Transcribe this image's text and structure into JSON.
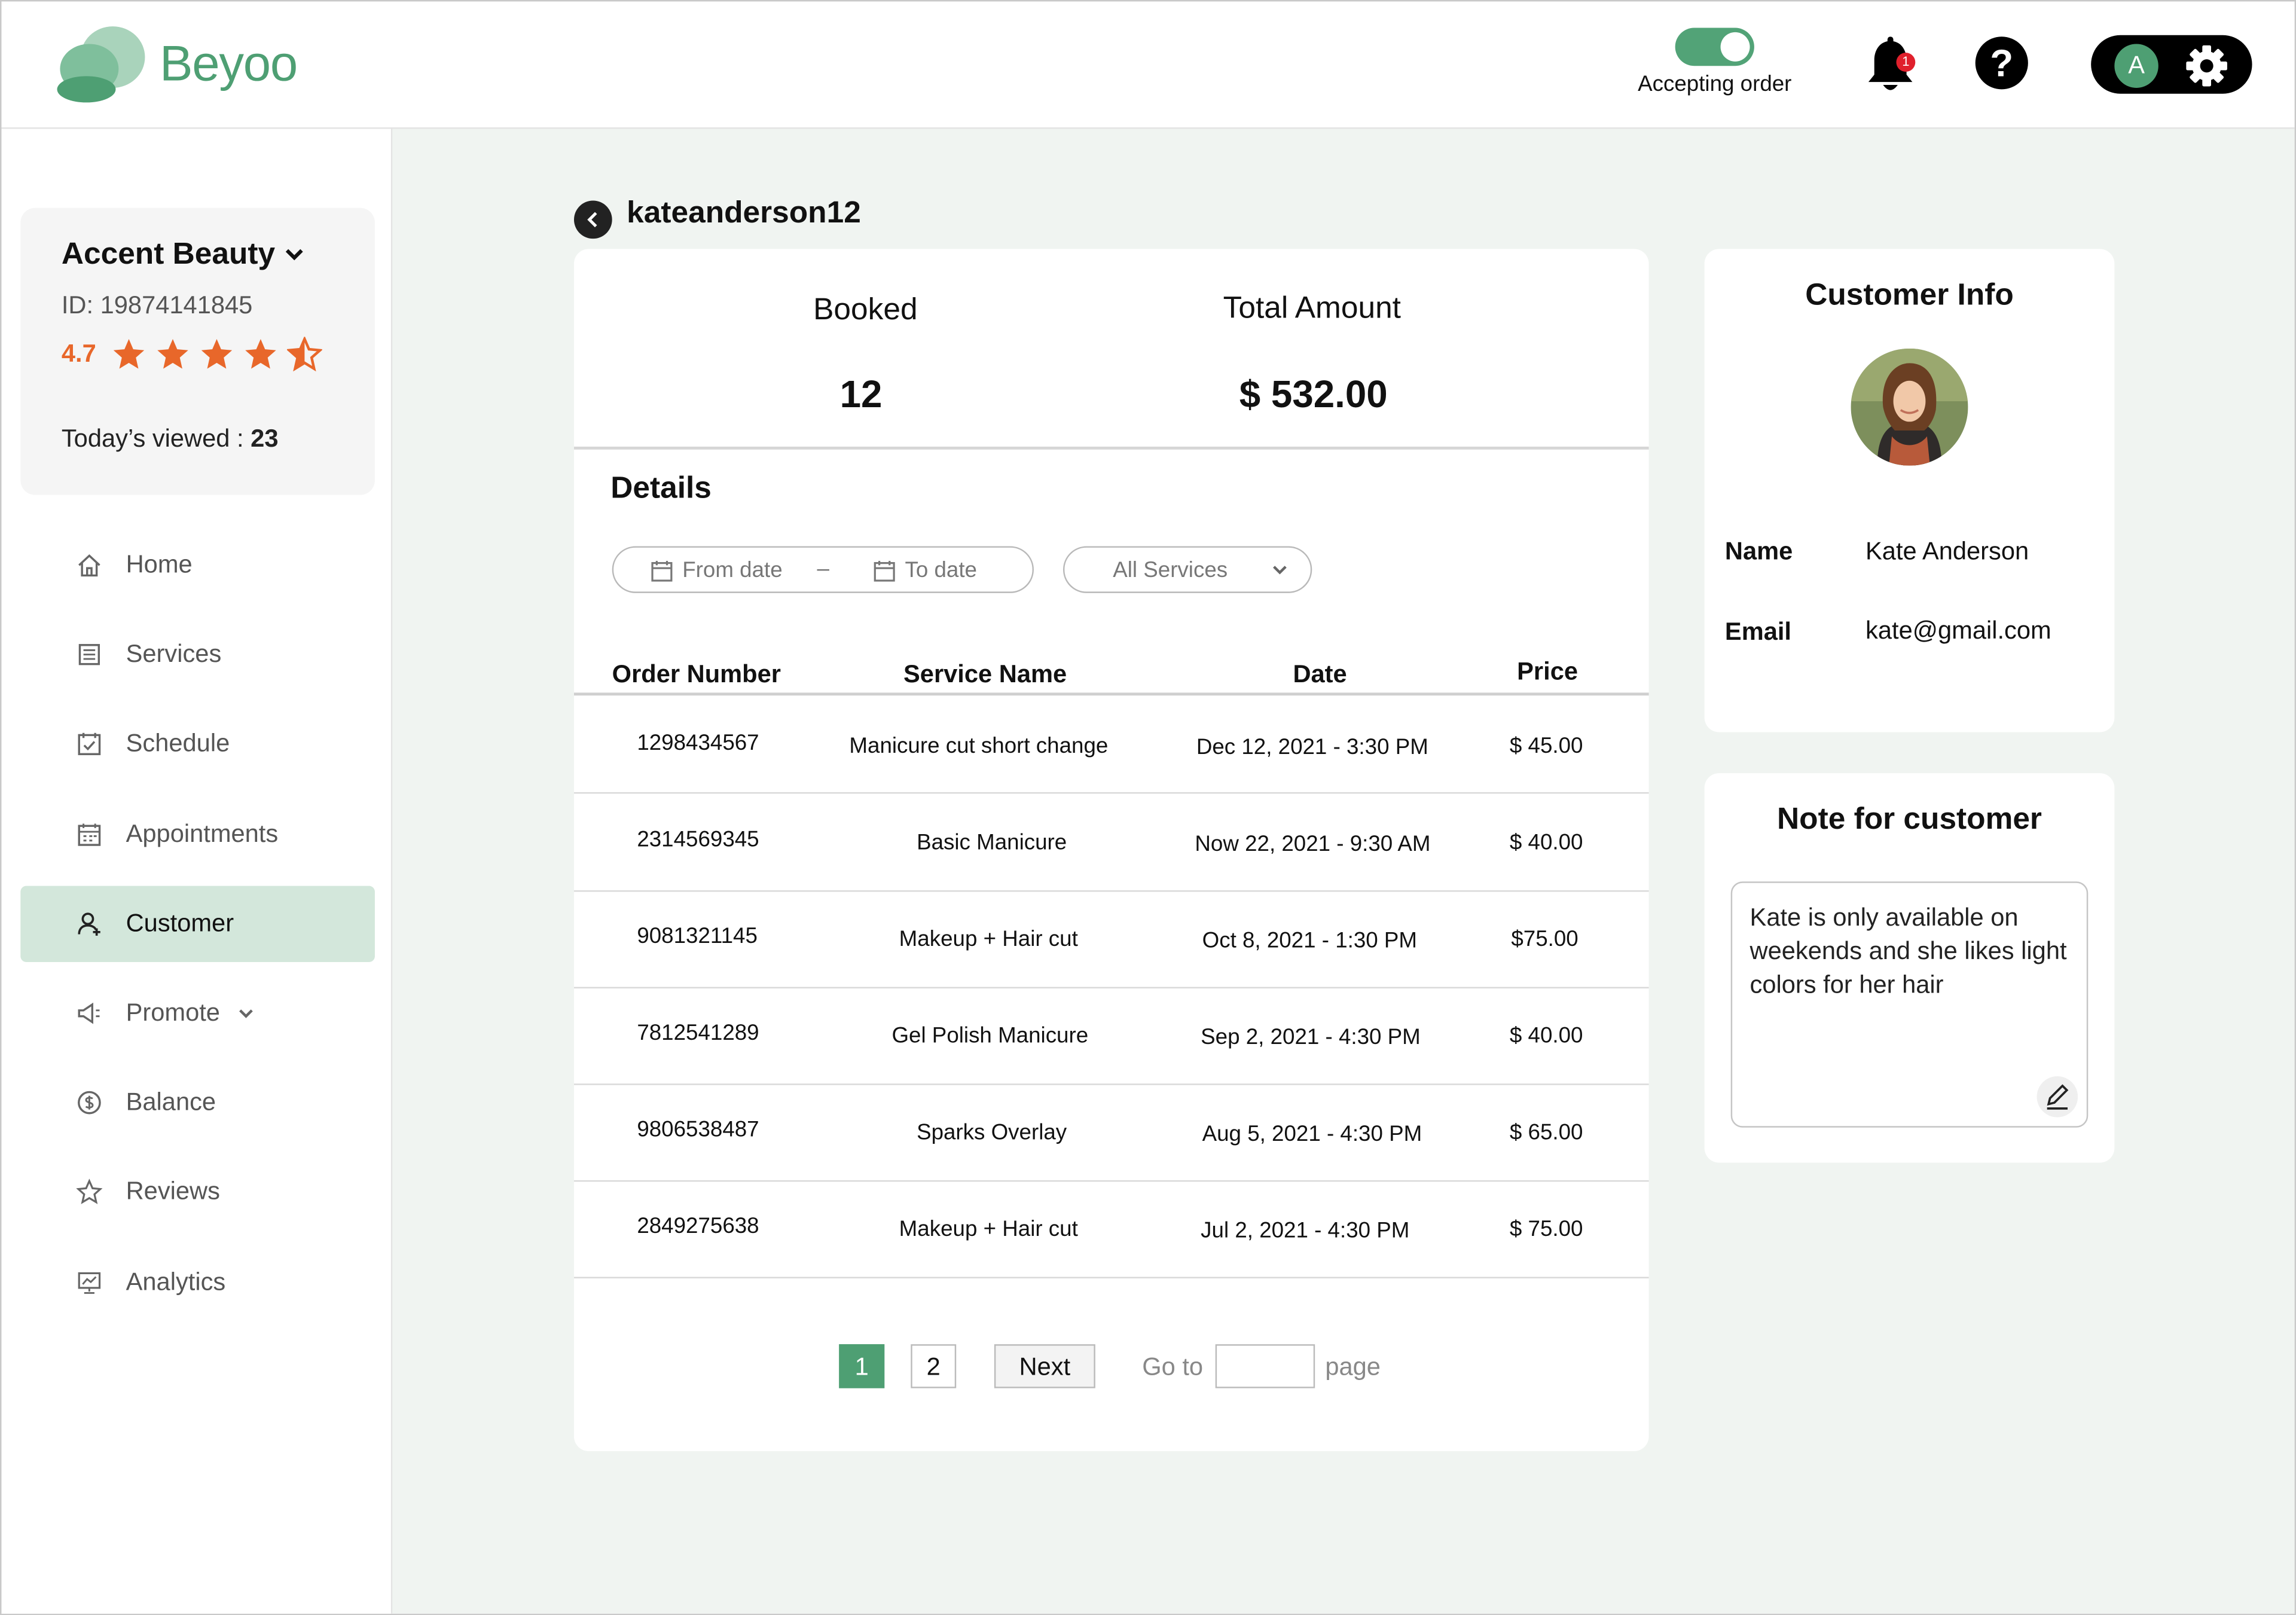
{
  "colors": {
    "accent": "#4e9f73",
    "active_nav": "#d3e7db",
    "rating": "#e8672a",
    "main_bg": "#f0f4f1",
    "badge": "#e0202c"
  },
  "brand": {
    "name": "Beyoo"
  },
  "header": {
    "accepting_label": "Accepting order",
    "accepting_on": true,
    "notification_count": "1",
    "help_glyph": "?",
    "avatar_initial": "A"
  },
  "store": {
    "name": "Accent Beauty",
    "id": "ID: 19874141845",
    "rating": "4.7",
    "stars": 4.5,
    "viewed_label": "Today’s viewed : ",
    "viewed_count": "23"
  },
  "nav": [
    {
      "label": "Home",
      "icon": "home-icon"
    },
    {
      "label": "Services",
      "icon": "list-icon"
    },
    {
      "label": "Schedule",
      "icon": "calendar-check-icon"
    },
    {
      "label": "Appointments",
      "icon": "calendar-grid-icon"
    },
    {
      "label": "Customer",
      "icon": "user-icon",
      "active": true
    },
    {
      "label": "Promote",
      "icon": "megaphone-icon"
    },
    {
      "label": "Balance",
      "icon": "dollar-circle-icon"
    },
    {
      "label": "Reviews",
      "icon": "star-outline-icon"
    },
    {
      "label": "Analytics",
      "icon": "analytics-icon"
    }
  ],
  "customer": {
    "username": "kateanderson12",
    "booked_label": "Booked",
    "booked_value": "12",
    "total_label": "Total Amount",
    "total_value": "$ 532.00"
  },
  "details": {
    "title": "Details",
    "from_placeholder": "From date",
    "separator": "–",
    "to_placeholder": "To date",
    "service_filter": "All Services",
    "columns": [
      "Order Number",
      "Service Name",
      "Date",
      "Price"
    ],
    "rows": [
      {
        "order": "1298434567",
        "service": "Manicure cut short change",
        "date": "Dec 12, 2021  - 3:30 PM",
        "price": "$ 45.00"
      },
      {
        "order": "2314569345",
        "service": "Basic Manicure",
        "date": "Now 22, 2021  - 9:30 AM",
        "price": "$ 40.00"
      },
      {
        "order": "9081321145",
        "service": "Makeup + Hair cut",
        "date": "Oct 8, 2021  - 1:30 PM",
        "price": "$75.00"
      },
      {
        "order": "7812541289",
        "service": "Gel Polish Manicure",
        "date": "Sep 2, 2021  - 4:30 PM",
        "price": "$ 40.00"
      },
      {
        "order": "9806538487",
        "service": "Sparks Overlay",
        "date": "Aug 5, 2021  - 4:30 PM",
        "price": "$ 65.00"
      },
      {
        "order": "2849275638",
        "service": "Makeup + Hair cut",
        "date": "Jul 2, 2021  - 4:30 PM",
        "price": "$ 75.00"
      }
    ]
  },
  "pagination": {
    "pages": [
      "1",
      "2"
    ],
    "current": "1",
    "next": "Next",
    "goto": "Go to",
    "page": "page"
  },
  "info": {
    "title": "Customer Info",
    "name_label": "Name",
    "name_value": "Kate Anderson",
    "email_label": "Email",
    "email_value": "kate@gmail.com"
  },
  "note": {
    "title": "Note for customer",
    "text": "Kate is only available on weekends and she likes light colors for her hair"
  }
}
